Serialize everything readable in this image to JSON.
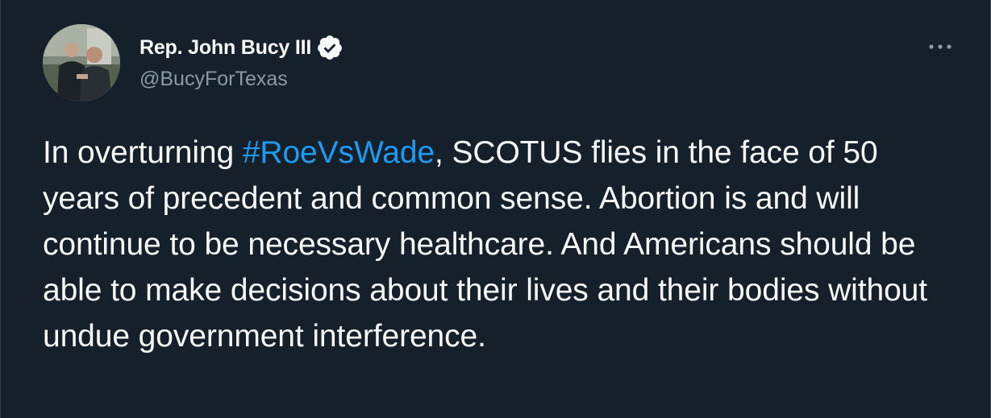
{
  "author": {
    "display_name": "Rep. John Bucy III",
    "handle": "@BucyForTexas",
    "verified_icon": "verified-badge-icon",
    "avatar_icon": "profile-photo"
  },
  "menu": {
    "icon": "more-options-icon"
  },
  "tweet": {
    "text_before": "In overturning ",
    "hashtag": "#RoeVsWade",
    "text_after": ", SCOTUS flies in the face of 50 years of precedent and common sense. Abortion is and will continue to be necessary healthcare. And Americans should be able to make decisions about their lives and their bodies without undue government interference."
  },
  "colors": {
    "background": "#15202b",
    "text_primary": "#f7f9f9",
    "text_secondary": "#8b98a5",
    "accent": "#1d9bf0"
  }
}
